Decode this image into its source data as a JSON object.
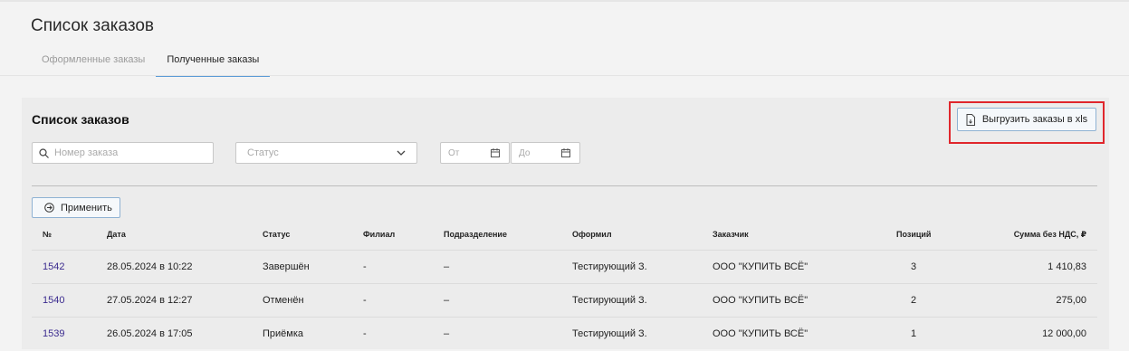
{
  "page": {
    "title": "Список заказов"
  },
  "tabs": [
    {
      "label": "Оформленные заказы",
      "active": false
    },
    {
      "label": "Полученные заказы",
      "active": true
    }
  ],
  "panel": {
    "title": "Список заказов",
    "export_label": "Выгрузить заказы в xls",
    "search_placeholder": "Номер заказа",
    "status_placeholder": "Статус",
    "date_from_placeholder": "От",
    "date_to_placeholder": "До",
    "apply_label": "Применить"
  },
  "table": {
    "headers": [
      "№",
      "Дата",
      "Статус",
      "Филиал",
      "Подразделение",
      "Оформил",
      "Заказчик",
      "Позиций",
      "Сумма без НДС, ₽"
    ],
    "rows": [
      [
        "1542",
        "28.05.2024 в 10:22",
        "Завершён",
        "-",
        "–",
        "Тестирующий З.",
        "ООО \"КУПИТЬ ВСЁ\"",
        "3",
        "1 410,83"
      ],
      [
        "1540",
        "27.05.2024 в 12:27",
        "Отменён",
        "-",
        "–",
        "Тестирующий З.",
        "ООО \"КУПИТЬ ВСЁ\"",
        "2",
        "275,00"
      ],
      [
        "1539",
        "26.05.2024 в 17:05",
        "Приёмка",
        "-",
        "–",
        "Тестирующий З.",
        "ООО \"КУПИТЬ ВСЁ\"",
        "1",
        "12 000,00"
      ]
    ]
  },
  "colors": {
    "highlight": "#e0262c",
    "accent": "#5a9bd6",
    "order_link": "#3b2b8f"
  }
}
